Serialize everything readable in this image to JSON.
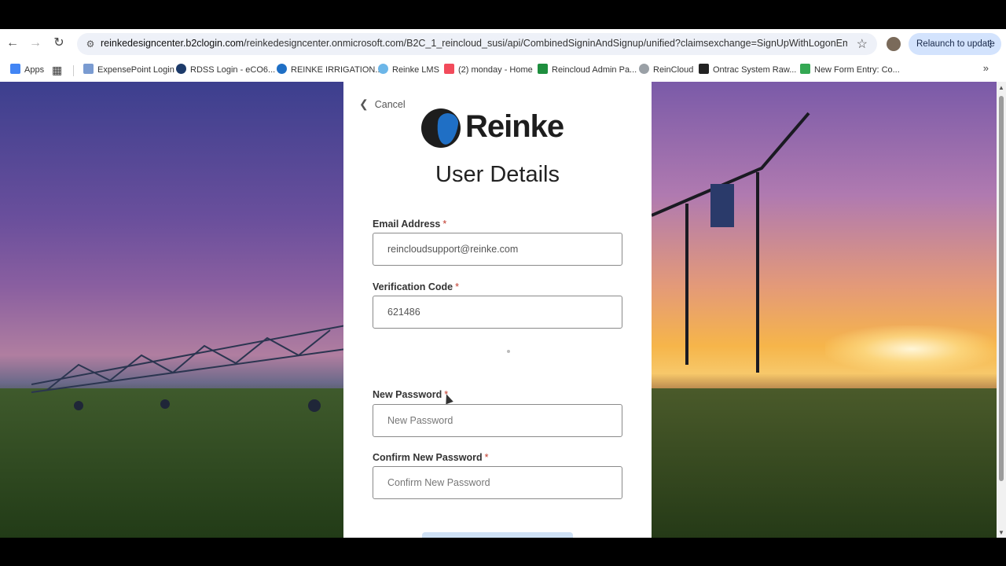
{
  "browser": {
    "url_host": "reinkedesigncenter.b2clogin.com",
    "url_path": "/reinkedesigncenter.onmicrosoft.com/B2C_1_reincloud_susi/api/CombinedSigninAndSignup/unified?claimsexchange=SignUpWithLogonEmailExchan...",
    "relaunch_label": "Relaunch to update",
    "bookmarks": [
      {
        "label": "Apps",
        "color": "#4285f4"
      },
      {
        "label": "ExpensePoint Login",
        "color": "#7a9bd1"
      },
      {
        "label": "RDSS Login - eCO6...",
        "color": "#1d3b6a"
      },
      {
        "label": "REINKE IRRIGATION...",
        "color": "#1f6fc5"
      },
      {
        "label": "Reinke LMS",
        "color": "#6cb6e8"
      },
      {
        "label": "(2) monday - Home",
        "color": "#f24b5b"
      },
      {
        "label": "Reincloud Admin Pa...",
        "color": "#1e8e3e"
      },
      {
        "label": "ReinCloud",
        "color": "#9aa0a6"
      },
      {
        "label": "Ontrac System Raw...",
        "color": "#222222"
      },
      {
        "label": "New Form Entry: Co...",
        "color": "#34a853"
      }
    ]
  },
  "form": {
    "cancel_label": "Cancel",
    "brand": "Reinke",
    "title": "User Details",
    "email_label": "Email Address",
    "email_value": "reincloudsupport@reinke.com",
    "code_label": "Verification Code",
    "code_value": "621486",
    "new_password_label": "New Password",
    "new_password_placeholder": "New Password",
    "confirm_password_label": "Confirm New Password",
    "confirm_password_placeholder": "Confirm New Password",
    "required_mark": "*"
  }
}
